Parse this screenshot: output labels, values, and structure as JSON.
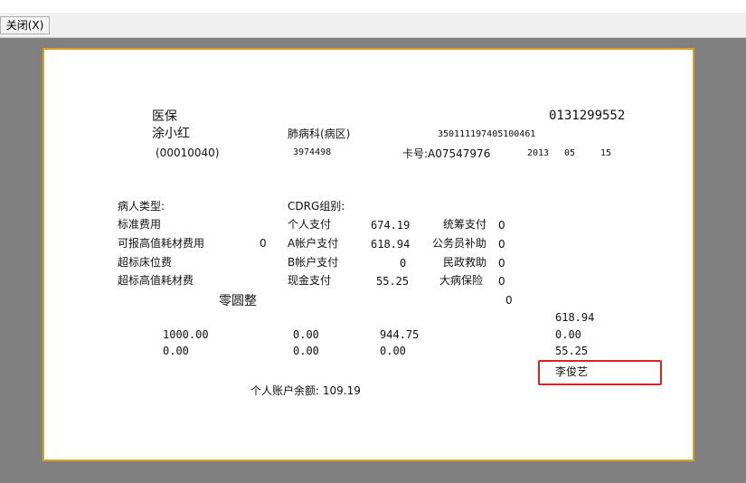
{
  "toolbar": {
    "close_label": "关闭(X)"
  },
  "colors": {
    "workspace": "#808080",
    "paper_border": "#d9a126",
    "highlight": "#e32020"
  },
  "receipt": {
    "insurance_type": "医保",
    "receipt_no": "0131299552",
    "patient_name": "涂小红",
    "department": "肺病科(病区)",
    "id_number": "350111197405100461",
    "patient_code": "(00010040)",
    "admission_no": "3974498",
    "card_number": "卡号:A07547976",
    "date": {
      "year": "2013",
      "month": "05",
      "day": "15"
    },
    "labels": {
      "patient_type": "病人类型:",
      "cdrg_group": "CDRG组别:",
      "standard_fee": "标准费用",
      "reimbursable_materials": "可报高值耗材费用",
      "over_bed_fee": "超标床位费",
      "over_materials": "超标高值耗材费",
      "personal_payment": "个人支付",
      "account_a": "A帐户支付",
      "account_b": "B帐户支付",
      "cash_payment": "现金支付",
      "pooled_payment": "统筹支付",
      "civil_servant_subsidy": "公务员补助",
      "civil_relief": "民政救助",
      "major_illness": "大病保险"
    },
    "values": {
      "reimbursable_materials": "0",
      "personal_payment": "674.19",
      "account_a": "618.94",
      "account_b": "0",
      "cash_payment": "55.25",
      "pooled_payment": "0",
      "civil_servant_subsidy": "0",
      "civil_relief": "0",
      "major_illness": "0"
    },
    "amount_words": "零圆整",
    "amount_zero": "0",
    "right_col_1": "618.94",
    "row1": [
      "1000.00",
      "0.00",
      "944.75",
      "0.00"
    ],
    "row2": [
      "0.00",
      "0.00",
      "0.00",
      "55.25"
    ],
    "operator": "李俊艺",
    "balance": "个人账户余额: 109.19"
  }
}
